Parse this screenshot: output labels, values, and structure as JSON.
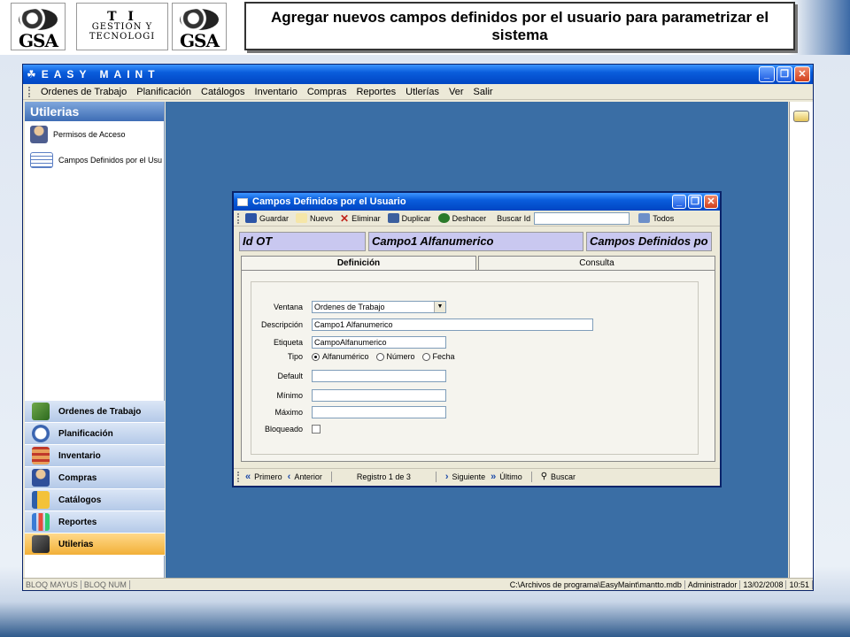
{
  "slide": {
    "title": "Agregar nuevos campos definidos por el usuario para parametrizar el sistema",
    "logo_left_text": "GSA",
    "logo_mid_line1": "T I",
    "logo_mid_line2": "GESTION Y",
    "logo_mid_line3": "TECNOLOGI",
    "logo_right_text": "GSA"
  },
  "app": {
    "title": "EASY MAINT",
    "menu": [
      "Ordenes de Trabajo",
      "Planificación",
      "Catálogos",
      "Inventario",
      "Compras",
      "Reportes",
      "Utlerías",
      "Ver",
      "Salir"
    ]
  },
  "left_panel": {
    "header": "Utilerias",
    "items": [
      {
        "label": "Permisos de Acceso",
        "icon": "user-lock-icon"
      },
      {
        "label": "Campos Definidos por el Usu",
        "icon": "form-icon"
      }
    ],
    "nav": [
      {
        "label": "Ordenes de Trabajo",
        "icon": "work-order-icon",
        "active": false
      },
      {
        "label": "Planificación",
        "icon": "clock-icon",
        "active": false
      },
      {
        "label": "Inventario",
        "icon": "shelves-icon",
        "active": false
      },
      {
        "label": "Compras",
        "icon": "buyer-icon",
        "active": false
      },
      {
        "label": "Catálogos",
        "icon": "catalog-icon",
        "active": false
      },
      {
        "label": "Reportes",
        "icon": "chart-icon",
        "active": false
      },
      {
        "label": "Utilerias",
        "icon": "tools-icon",
        "active": true
      }
    ]
  },
  "dialog": {
    "title": "Campos Definidos por el Usuario",
    "toolbar": {
      "guardar": "Guardar",
      "nuevo": "Nuevo",
      "eliminar": "Eliminar",
      "duplicar": "Duplicar",
      "deshacer": "Deshacer",
      "buscar_id": "Buscar Id",
      "todos": "Todos"
    },
    "header_cells": [
      "Id  OT",
      "Campo1 Alfanumerico",
      "Campos Definidos po"
    ],
    "tabs": [
      "Definición",
      "Consulta"
    ],
    "form": {
      "ventana_label": "Ventana",
      "ventana_value": "Ordenes de Trabajo",
      "descripcion_label": "Descripción",
      "descripcion_value": "Campo1 Alfanumerico",
      "etiqueta_label": "Etiqueta",
      "etiqueta_value": "CampoAlfanumerico",
      "tipo_label": "Tipo",
      "tipo_options": [
        "Alfanumérico",
        "Número",
        "Fecha"
      ],
      "tipo_selected": "Alfanumérico",
      "default_label": "Default",
      "minimo_label": "Mínimo",
      "maximo_label": "Máximo",
      "bloqueado_label": "Bloqueado"
    },
    "navbar": {
      "primero": "Primero",
      "anterior": "Anterior",
      "registro": "Registro 1 de 3",
      "siguiente": "Siguiente",
      "ultimo": "Último",
      "buscar": "Buscar"
    }
  },
  "status": {
    "caps": "BLOQ MAYUS",
    "num": "BLOQ NUM",
    "path": "C:\\Archivos de programa\\EasyMaint\\mantto.mdb",
    "user": "Administrador",
    "date": "13/02/2008",
    "time": "10:51"
  },
  "colors": {
    "desktop": "#3a6ea5",
    "titlebar": "#0a5ddc",
    "header_cells": "#c9c8f0",
    "nav_active": "#f2b038"
  }
}
